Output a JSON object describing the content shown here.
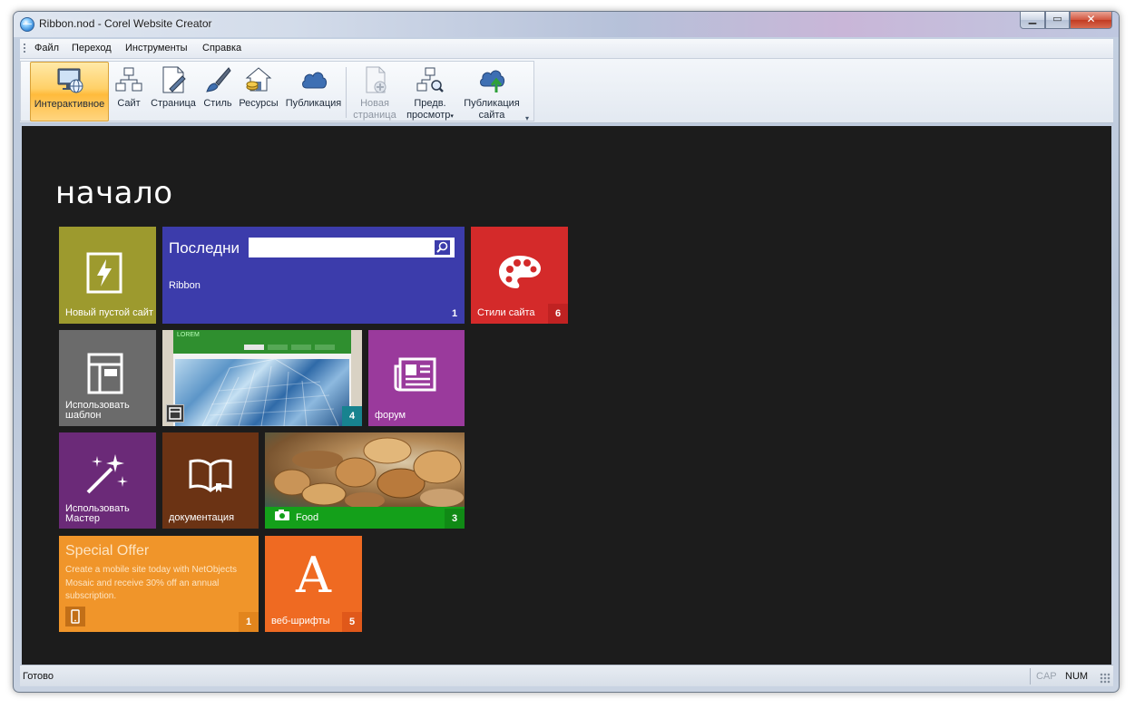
{
  "window": {
    "title": "Ribbon.nod - Corel Website Creator"
  },
  "menu": {
    "items": [
      "Файл",
      "Переход",
      "Инструменты",
      "Справка"
    ]
  },
  "ribbon": {
    "buttons": [
      {
        "label": "Интерактивное",
        "icon": "monitor-globe-icon",
        "active": true
      },
      {
        "label": "Сайт",
        "icon": "site-tree-icon"
      },
      {
        "label": "Страница",
        "icon": "page-edit-icon"
      },
      {
        "label": "Стиль",
        "icon": "paintbrush-icon"
      },
      {
        "label": "Ресурсы",
        "icon": "resources-house-icon"
      },
      {
        "label": "Публикация",
        "icon": "cloud-icon"
      },
      {
        "label": "Новая страница",
        "line1": "Новая",
        "line2": "страница",
        "icon": "new-page-icon",
        "disabled": true
      },
      {
        "label": "Предв. просмотр",
        "line1": "Предв.",
        "line2": "просмотр",
        "icon": "preview-tree-icon",
        "dropdown": true
      },
      {
        "label": "Публикация сайта",
        "line1": "Публикация",
        "line2": "сайта",
        "icon": "cloud-upload-icon"
      }
    ]
  },
  "start": {
    "title": "начало",
    "tiles": {
      "new_site": {
        "label": "Новый пустой сайт",
        "color": "#9d9a2e"
      },
      "recent": {
        "title": "Последни",
        "item": "Ribbon",
        "badge": "1",
        "color": "#3c3cab"
      },
      "styles": {
        "label": "Стили сайта",
        "badge": "6",
        "color": "#d42a2a"
      },
      "template": {
        "label_line1": "Использовать",
        "label_line2": "шаблон",
        "color": "#6b6b6b"
      },
      "photo": {
        "badge": "4",
        "header": "LOREM"
      },
      "forum": {
        "label": "форум",
        "color": "#9a3a9c"
      },
      "wizard": {
        "label_line1": "Использовать",
        "label_line2": "Мастер",
        "color": "#6b2a78"
      },
      "docs": {
        "label": "документация",
        "color": "#6b3314"
      },
      "food": {
        "label": "Food",
        "badge": "3",
        "color": "#14a01a"
      },
      "offer": {
        "title": "Special Offer",
        "text": "Create a mobile site today with NetObjects Mosaic and receive 30% off an annual subscription.",
        "badge": "1",
        "color": "#f0952a"
      },
      "fonts": {
        "label": "веб-шрифты",
        "glyph": "A",
        "badge": "5",
        "color": "#ef6a22"
      }
    }
  },
  "status": {
    "text": "Готово",
    "cap": "CAP",
    "num": "NUM"
  }
}
